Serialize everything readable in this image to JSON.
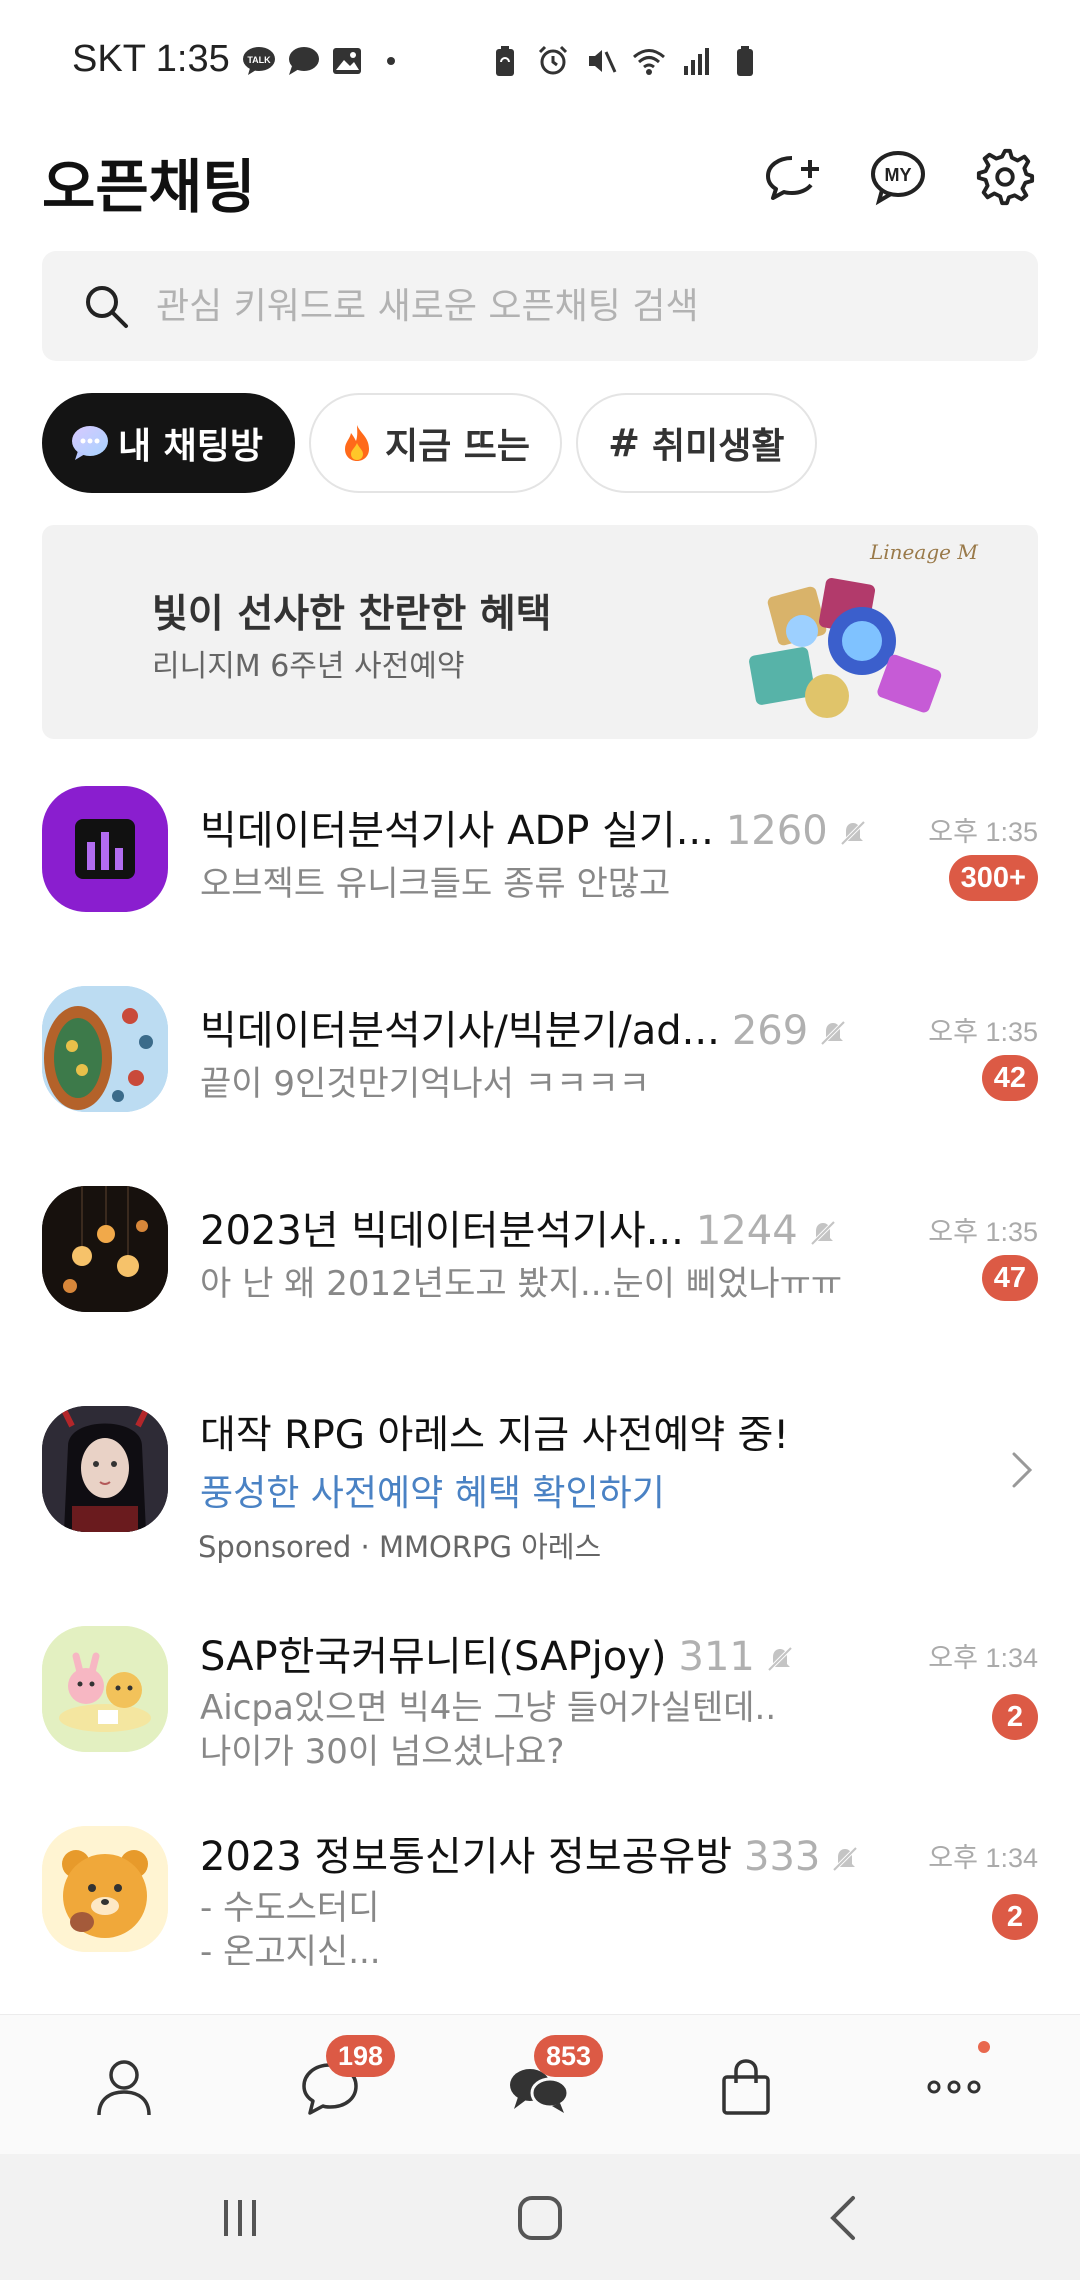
{
  "status_bar": {
    "carrier_time": "SKT 1:35",
    "left_icons": [
      "talk-icon",
      "chat-bubble-icon",
      "image-icon",
      "dot-icon"
    ],
    "right_icons": [
      "battery-saver-icon",
      "alarm-icon",
      "mute-icon",
      "wifi-icon",
      "signal-icon",
      "battery-icon"
    ]
  },
  "header": {
    "title": "오픈채팅",
    "buttons": [
      "new-chat-icon",
      "my-icon",
      "gear-icon"
    ],
    "my_label": "MY"
  },
  "search": {
    "placeholder": "관심 키워드로 새로운 오픈채팅 검색"
  },
  "chips": [
    {
      "label": "내 채팅방",
      "icon": "chat-bubble-icon",
      "active": true
    },
    {
      "label": "지금 뜨는",
      "icon": "fire-icon",
      "active": false
    },
    {
      "label": "취미생활",
      "icon": "hash-icon",
      "active": false
    }
  ],
  "banner": {
    "title": "빛이 선사한 찬란한 혜택",
    "subtitle": "리니지M 6주년 사전예약",
    "art_text": "Lineage M"
  },
  "chats": [
    {
      "title": "빅데이터분석기사 ADP 실기...",
      "count": "1260",
      "message": "오브젝트 유니크들도 종류 안많고",
      "time": "오후 1:35",
      "badge": "300+"
    },
    {
      "title": "빅데이터분석기사/빅분기/ad...",
      "count": "269",
      "message": "끝이 9인것만기억나서 ㅋㅋㅋㅋ",
      "time": "오후 1:35",
      "badge": "42"
    },
    {
      "title": "2023년 빅데이터분석기사...",
      "count": "1244",
      "message": "아 난 왜 2012년도고 봤지...눈이 삐었나ㅠㅠ",
      "time": "오후 1:35",
      "badge": "47"
    }
  ],
  "ad": {
    "title": "대작 RPG 아레스 지금 사전예약 중!",
    "link": "풍성한 사전예약 혜택 확인하기",
    "meta": "Sponsored · MMORPG 아레스"
  },
  "chats_more": [
    {
      "title": "SAP한국커뮤니티(SAPjoy)",
      "count": "311",
      "message_line1": "Aicpa있으면 빅4는 그냥 들어가실텐데..",
      "message_line2": "나이가 30이 넘으셨나요?",
      "time": "오후 1:34",
      "badge": "2"
    },
    {
      "title": "2023 정보통신기사 정보공유방",
      "count": "333",
      "message_line1": "- 수도스터디",
      "message_line2": "- 온고지신...",
      "time": "오후 1:34",
      "badge": "2"
    }
  ],
  "bottom_nav": {
    "items": [
      "friends-icon",
      "chats-icon",
      "openchat-icon",
      "shopping-icon",
      "more-icon"
    ],
    "chats_badge": "198",
    "openchat_badge": "853"
  },
  "system_nav": [
    "recent-apps-icon",
    "home-icon",
    "back-icon"
  ],
  "colors": {
    "badge": "#dc5a45",
    "link": "#4a82c4",
    "chip_active": "#141414",
    "openchat_purple": "#8a1ecf"
  }
}
